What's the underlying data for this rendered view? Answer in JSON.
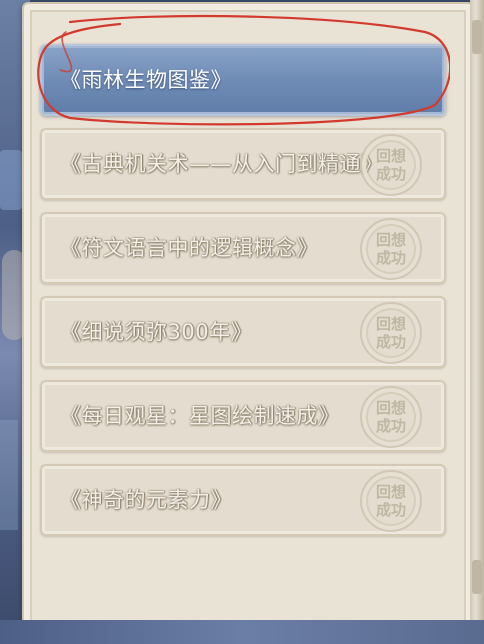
{
  "book_list": {
    "entries": [
      {
        "title": "《雨林生物图鉴》",
        "selected": true,
        "stamp": null
      },
      {
        "title": "《古典机关术——从入门到精通》",
        "selected": false,
        "stamp": {
          "line1": "回想",
          "line2": "成功"
        }
      },
      {
        "title": "《符文语言中的逻辑概念》",
        "selected": false,
        "stamp": {
          "line1": "回想",
          "line2": "成功"
        }
      },
      {
        "title": "《细说须弥300年》",
        "selected": false,
        "stamp": {
          "line1": "回想",
          "line2": "成功"
        }
      },
      {
        "title": "《每日观星：星图绘制速成》",
        "selected": false,
        "stamp": {
          "line1": "回想",
          "line2": "成功"
        }
      },
      {
        "title": "《神奇的元素力》",
        "selected": false,
        "stamp": {
          "line1": "回想",
          "line2": "成功"
        }
      }
    ]
  },
  "colors": {
    "selected_bg": "#6f8cb6",
    "entry_bg": "#e4ddcf",
    "annotation_red": "#d23a2e"
  }
}
